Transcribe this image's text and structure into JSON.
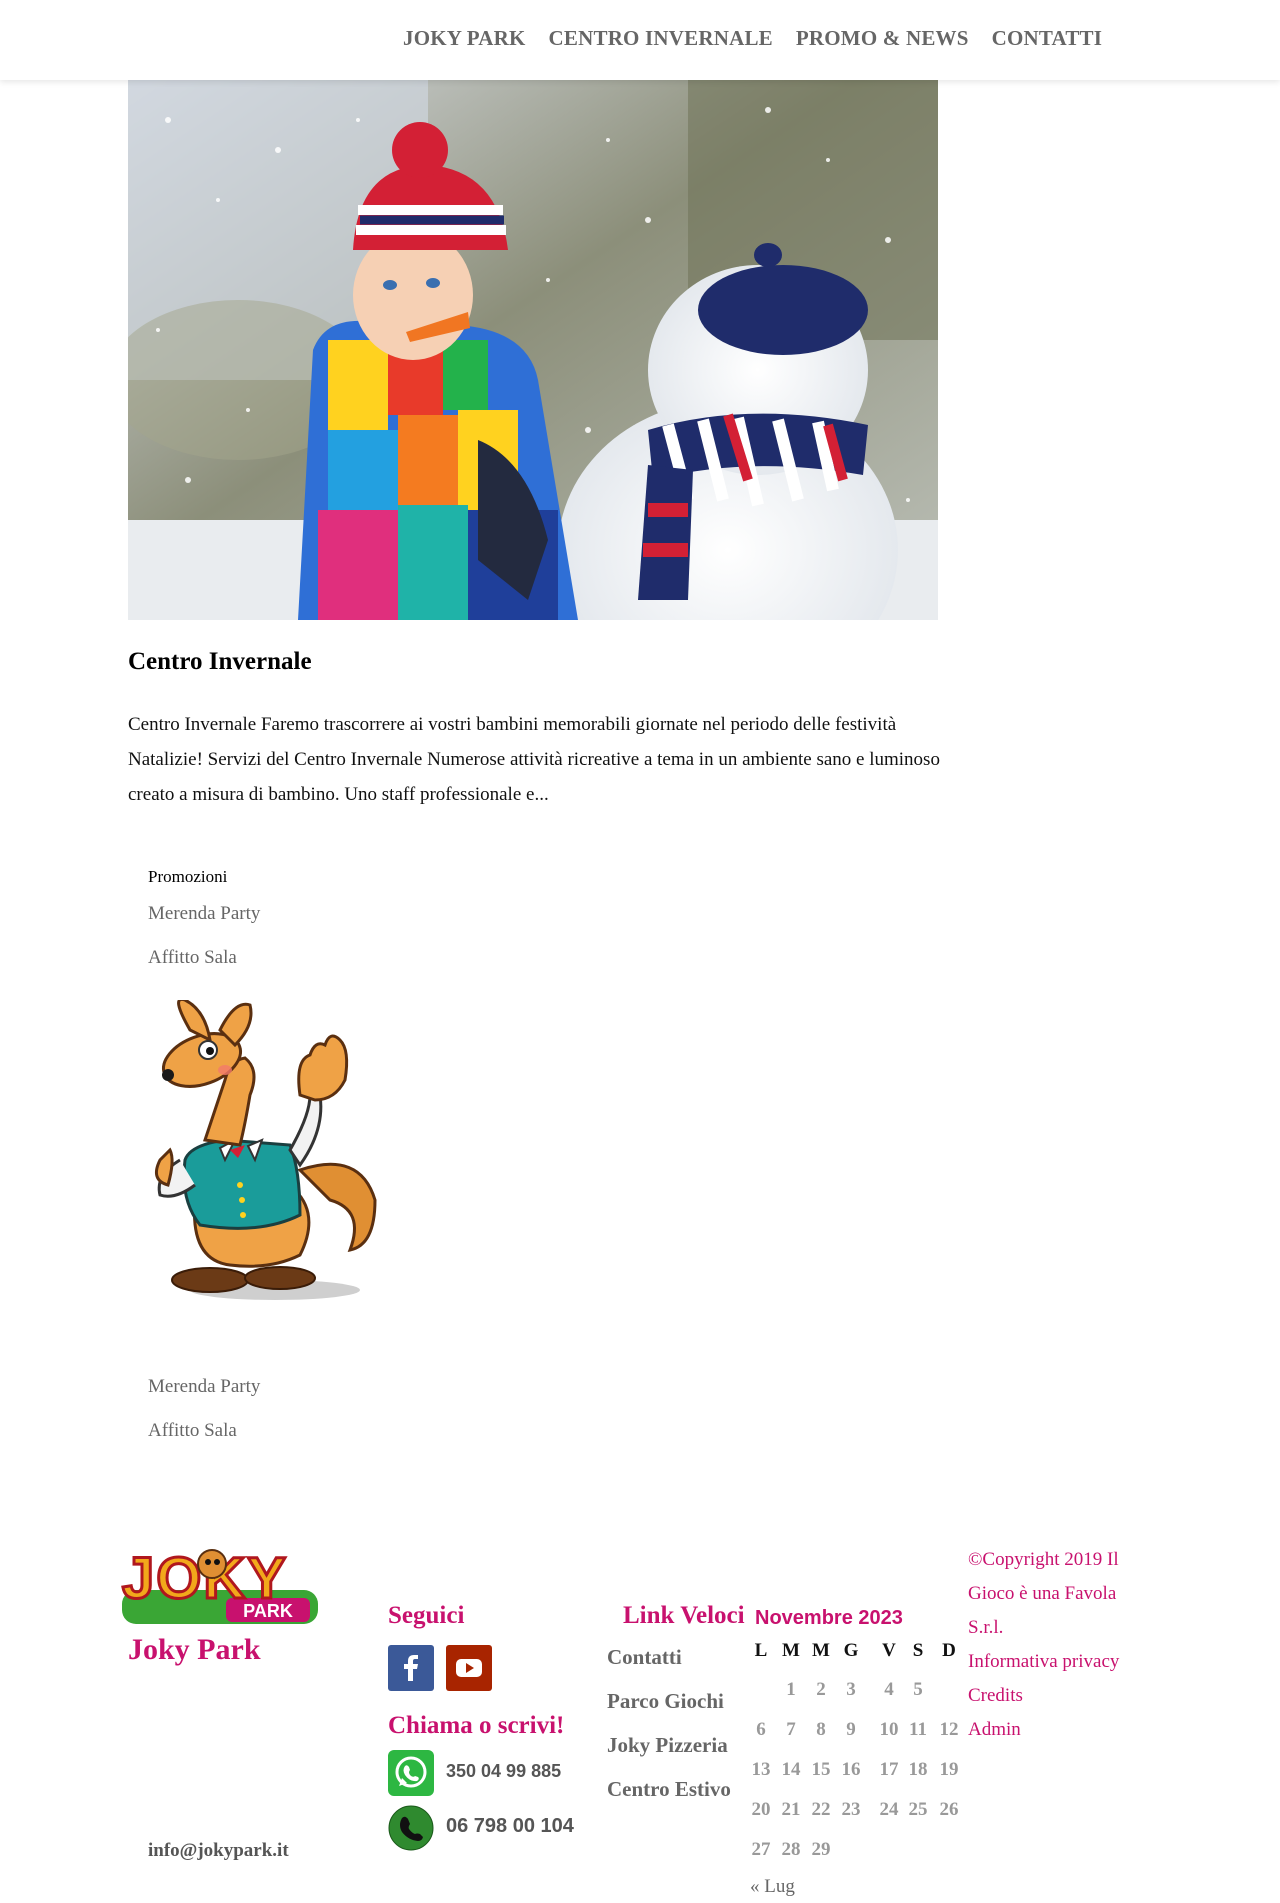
{
  "nav": {
    "items": [
      "JOKY PARK",
      "CENTRO INVERNALE",
      "PROMO & NEWS",
      "CONTATTI"
    ]
  },
  "post": {
    "title": "Centro Invernale",
    "excerpt": "Centro Invernale Faremo trascorrere ai vostri bambini memorabili giornate nel periodo delle festività Natalizie! Servizi del Centro Invernale Numerose attività ricreative a tema in un ambiente sano e luminoso creato a misura di bambino. Uno staff professionale e..."
  },
  "promotions": {
    "heading": "Promozioni",
    "links": [
      "Merenda Party",
      "Affitto Sala"
    ],
    "links_bottom": [
      "Merenda Party",
      "Affitto Sala"
    ]
  },
  "footer": {
    "logo_text": "JOKY",
    "logo_subtext": "PARK",
    "brand_title": "Joky Park",
    "email": "info@jokypark.it",
    "follow_heading": "Seguici",
    "call_heading": "Chiama o scrivi!",
    "whatsapp_number": "350 04 99 885",
    "phone_number": "06 798 00 104",
    "quick_links_heading": "Link Veloci",
    "quick_links": [
      "Contatti",
      "Parco Giochi",
      "Joky Pizzeria",
      "Centro Estivo"
    ],
    "copyright": "©Copyright 2019 Il Gioco è una Favola S.r.l.",
    "legal_links": [
      "Informativa privacy",
      "Credits",
      "Admin"
    ]
  },
  "calendar": {
    "caption": "Novembre 2023",
    "weekdays": [
      "L",
      "M",
      "M",
      "G",
      "V",
      "S",
      "D"
    ],
    "weeks": [
      [
        "",
        "",
        "1",
        "2",
        "3",
        "4",
        "5"
      ],
      [
        "6",
        "7",
        "8",
        "9",
        "10",
        "11",
        "12"
      ],
      [
        "13",
        "14",
        "15",
        "16",
        "17",
        "18",
        "19"
      ],
      [
        "20",
        "21",
        "22",
        "23",
        "24",
        "25",
        "26"
      ],
      [
        "27",
        "28",
        "29",
        "",
        "",
        "",
        ""
      ]
    ],
    "prev_link": "« Lug"
  },
  "colors": {
    "accent": "#c8116e",
    "nav_text": "#666666",
    "facebook": "#3b5998",
    "youtube": "#a82400"
  },
  "icons": [
    "facebook-icon",
    "youtube-icon",
    "whatsapp-icon",
    "phone-icon"
  ]
}
